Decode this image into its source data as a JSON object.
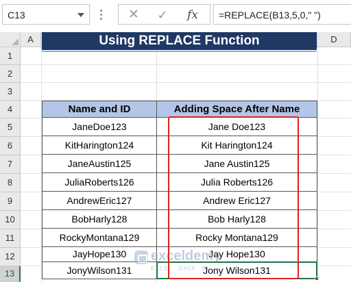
{
  "formula_bar": {
    "name_box": "C13",
    "fx_label": "fx",
    "cancel_symbol": "✕",
    "enter_symbol": "✓",
    "formula": "=REPLACE(B13,5,0,\" \")"
  },
  "sheet": {
    "columns": [
      "A",
      "B",
      "C",
      "D"
    ],
    "rows": [
      "1",
      "2",
      "3",
      "4",
      "5",
      "6",
      "7",
      "8",
      "9",
      "10",
      "11",
      "12",
      "13"
    ],
    "active_column": "C",
    "active_row": "13"
  },
  "title": "Using REPLACE Function",
  "table": {
    "headers": [
      "Name and ID",
      "Adding Space After Name"
    ],
    "rows": [
      [
        "JaneDoe123",
        "Jane Doe123"
      ],
      [
        "KitHarington124",
        "Kit Harington124"
      ],
      [
        "JaneAustin125",
        "Jane Austin125"
      ],
      [
        "JuliaRoberts126",
        "Julia Roberts126"
      ],
      [
        "AndrewEric127",
        "Andrew Eric127"
      ],
      [
        "BobHarly128",
        "Bob Harly128"
      ],
      [
        "RockyMontana129",
        "Rocky Montana129"
      ],
      [
        "JayHope130",
        "Jay Hope130"
      ],
      [
        "JonyWilson131",
        "Jony Wilson131"
      ]
    ]
  },
  "watermark": {
    "name": "exceldemy",
    "tagline": "EXCEL · DATA · BI"
  },
  "colors": {
    "title_bg": "#1f3864",
    "header_bg": "#b4c6e7",
    "selection": "#217346",
    "highlight": "#e02020"
  }
}
